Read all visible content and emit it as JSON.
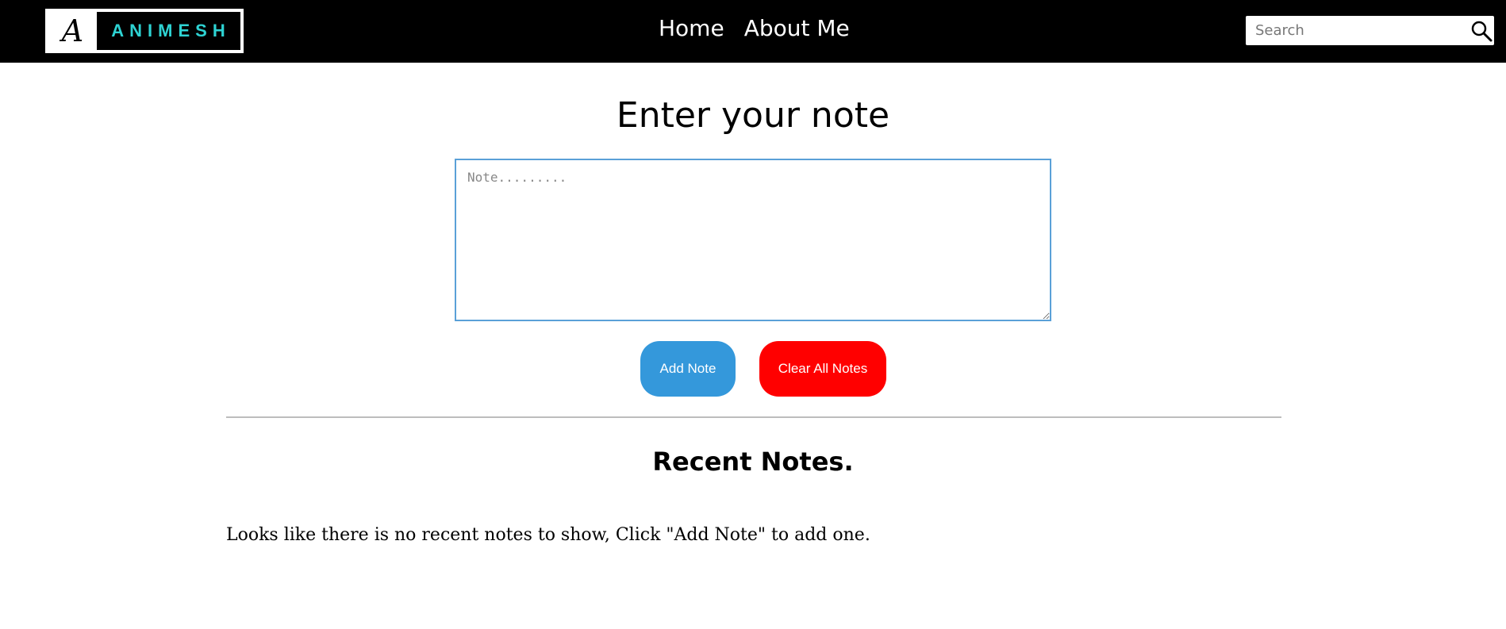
{
  "header": {
    "logo_mark": "A",
    "logo_text": "ANIMESH",
    "nav": [
      {
        "label": "Home"
      },
      {
        "label": "About Me"
      }
    ],
    "search_placeholder": "Search"
  },
  "main": {
    "heading": "Enter your note",
    "note_placeholder": "Note.........",
    "add_button": "Add Note",
    "clear_button": "Clear All Notes",
    "recent_title": "Recent Notes.",
    "empty_message": "Looks like there is no recent notes to show, Click \"Add Note\" to add one."
  },
  "colors": {
    "navbar_bg": "#000000",
    "logo_accent": "#2ed3d3",
    "add_button_bg": "#3498db",
    "clear_button_bg": "#ff0000",
    "textarea_border": "#5aa0d8"
  },
  "icons": {
    "search": "search-icon"
  }
}
